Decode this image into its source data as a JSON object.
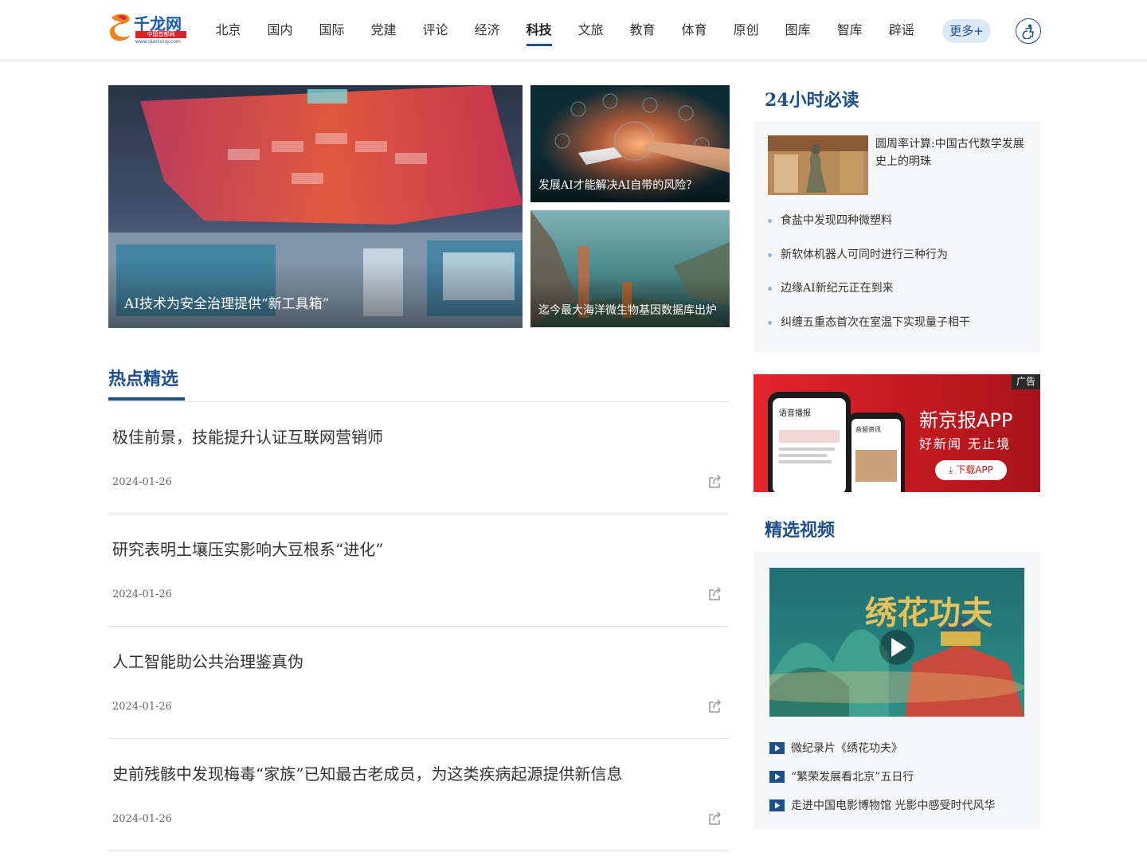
{
  "header": {
    "logo_text": "千龙网",
    "logo_tag": "中国首都网",
    "logo_url": "www.qianlong.com",
    "nav": [
      {
        "label": "北京"
      },
      {
        "label": "国内"
      },
      {
        "label": "国际"
      },
      {
        "label": "党建"
      },
      {
        "label": "评论"
      },
      {
        "label": "经济"
      },
      {
        "label": "科技",
        "active": true
      },
      {
        "label": "文旅"
      },
      {
        "label": "教育"
      },
      {
        "label": "体育"
      },
      {
        "label": "原创"
      },
      {
        "label": "图库"
      },
      {
        "label": "智库"
      },
      {
        "label": "辟谣"
      }
    ],
    "more_label": "更多+",
    "icons": {
      "accessibility": "accessibility-icon"
    }
  },
  "hero": {
    "main_caption": "AI技术为安全治理提供“新工具箱”",
    "side1_caption": "发展AI才能解决AI自带的风险？",
    "side2_caption": "迄今最大海洋微生物基因数据库出炉"
  },
  "hot": {
    "title": "热点精选",
    "items": [
      {
        "title": "极佳前景，技能提升认证互联网营销师",
        "date": "2024-01-26"
      },
      {
        "title": "研究表明土壤压实影响大豆根系“进化”",
        "date": "2024-01-26"
      },
      {
        "title": "人工智能助公共治理鉴真伪",
        "date": "2024-01-26"
      },
      {
        "title": "史前残骸中发现梅毒“家族”已知最古老成员，为这类疾病起源提供新信息",
        "date": "2024-01-26"
      }
    ]
  },
  "read24": {
    "title": "24小时必读",
    "featured": "圆周率计算:中国古代数学发展史上的明珠",
    "items": [
      {
        "label": "食盐中发现四种微塑料"
      },
      {
        "label": "新软体机器人可同时进行三种行为"
      },
      {
        "label": "边缘AI新纪元正在到来"
      },
      {
        "label": "纠缠五重态首次在室温下实现量子相干"
      }
    ]
  },
  "ad": {
    "badge": "广告",
    "title": "新京报APP",
    "slogan": "好新闻  无止境",
    "button": "下载APP",
    "screen_label_1": "语音播报",
    "screen_label_2": "音频资讯"
  },
  "video": {
    "title": "精选视频",
    "thumb_caption": "绣花功夫",
    "items": [
      {
        "label": "微纪录片《绣花功夫》"
      },
      {
        "label": "“繁荣发展看北京”五日行"
      },
      {
        "label": "走进中国电影博物馆 光影中感受时代风华"
      }
    ]
  },
  "colors": {
    "brand_blue": "#1f4e8c",
    "ad_red": "#d8232a",
    "panel_bg": "#f5f6f8"
  }
}
